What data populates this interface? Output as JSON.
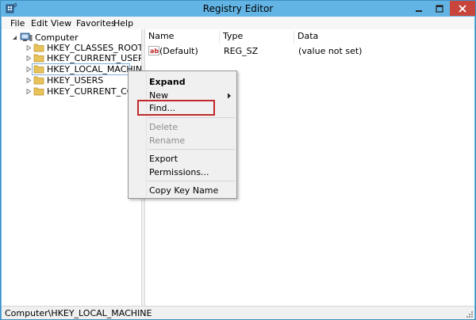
{
  "window": {
    "title": "Registry Editor",
    "controls": {
      "minimize": "–",
      "maximize": "□",
      "close": "✕"
    }
  },
  "menubar": {
    "items": [
      "File",
      "Edit",
      "View",
      "Favorites",
      "Help"
    ]
  },
  "tree": {
    "root": "Computer",
    "items": [
      {
        "label": "HKEY_CLASSES_ROOT"
      },
      {
        "label": "HKEY_CURRENT_USER"
      },
      {
        "label": "HKEY_LOCAL_MACHINE",
        "selected": true
      },
      {
        "label": "HKEY_USERS"
      },
      {
        "label": "HKEY_CURRENT_CONFIG"
      }
    ]
  },
  "list": {
    "columns": [
      "Name",
      "Type",
      "Data"
    ],
    "rows": [
      {
        "name": "(Default)",
        "type": "REG_SZ",
        "data": "(value not set)",
        "icon": "string-value-icon"
      }
    ]
  },
  "context_menu": {
    "items": [
      {
        "label": "Expand",
        "bold": true
      },
      {
        "label": "New",
        "submenu": true
      },
      {
        "label": "Find...",
        "highlighted": true
      },
      {
        "label": "Delete",
        "disabled": true
      },
      {
        "label": "Rename",
        "disabled": true
      },
      {
        "label": "Export"
      },
      {
        "label": "Permissions..."
      },
      {
        "label": "Copy Key Name"
      }
    ]
  },
  "statusbar": {
    "path": "Computer\\HKEY_LOCAL_MACHINE"
  },
  "colors": {
    "titlebar": "#62b4e4",
    "close_button": "#c7453a",
    "highlight_box": "#c0292b",
    "folder": "#e8c35a"
  }
}
